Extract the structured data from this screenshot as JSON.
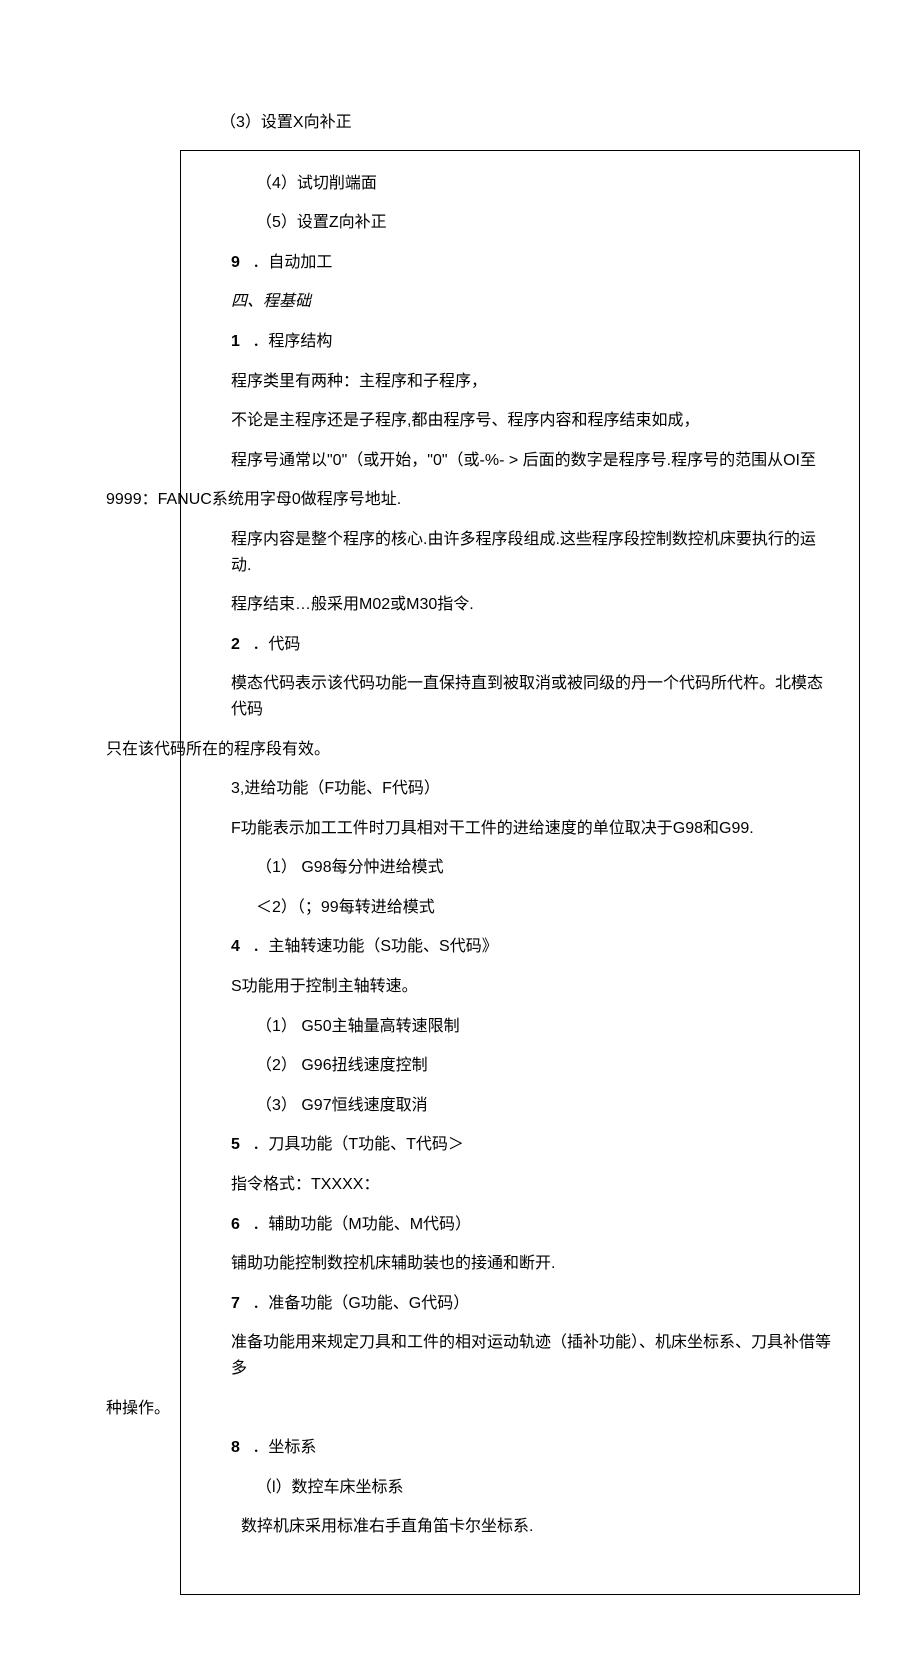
{
  "section_top": {
    "item3": "（3）设置X向补正"
  },
  "frame": {
    "item4": "（4）试切削端面",
    "item5": "（5）设置Z向补正",
    "step9_num": "9",
    "step9_text": "．自动加工",
    "sec4_head": "四、程基础",
    "p1_num": "1",
    "p1_title": "．程序结构",
    "p1_l1": "程序类里有两种：主程序和子程序，",
    "p1_l2": "不论是主程序还是子程序,都由程序号、程序内容和程序结束如成，",
    "p1_l3a": "程序号通常以\"0\"（或开始，\"0\"（或-%- > 后面的数字是程序号.程序号的范围从OI至",
    "p1_l3b": "9999：FANUC系统用字母0做程序号地址.",
    "p1_l4": "程序内容是整个程序的核心.由许多程序段组成.这些程序段控制数控机床要执行的运动.",
    "p1_l5": "程序结束…般采用M02或M30指令.",
    "p2_num": "2",
    "p2_title": "．代码",
    "p2_l1a": "模态代码表示该代码功能一直保持直到被取消或被同级的丹一个代码所代杵。北模态代码",
    "p2_l1b": "只在该代码所在的程序段有效。",
    "p3_head": "3,进给功能（F功能、F代码）",
    "p3_l1": "F功能表示加工工件时刀具相对干工件的进给速度的单位取决于G98和G99.",
    "p3_sub1": "（1） G98每分忡进给模式",
    "p3_sub2": "＜2）（；99每转进给模式",
    "p4_num": "4",
    "p4_title": "．主轴转速功能（S功能、S代码》",
    "p4_l1": "S功能用于控制主轴转速。",
    "p4_sub1": "（1） G50主轴量高转速限制",
    "p4_sub2": "（2） G96扭线速度控制",
    "p4_sub3": "（3） G97恒线速度取消",
    "p5_num": "5",
    "p5_title": "．刀具功能（T功能、T代码＞",
    "p5_l1": "指令格式：TXXXX：",
    "p6_num": "6",
    "p6_title": "．辅助功能（M功能、M代码）",
    "p6_l1": "铺助功能控制数控机床辅助装也的接通和断开.",
    "p7_num": "7",
    "p7_title": "．准备功能（G功能、G代码）",
    "p7_l1a": "准备功能用来规定刀具和工件的相对运动轨迹（插补功能）、机床坐标系、刀具补借等多",
    "p7_l1b": "种操作。",
    "p8_num": "8",
    "p8_title": "．坐标系",
    "p8_sub1": "（l）数控车床坐标系",
    "p8_l1": "数捽机床采用标准右手直角笛卡尔坐标系."
  }
}
